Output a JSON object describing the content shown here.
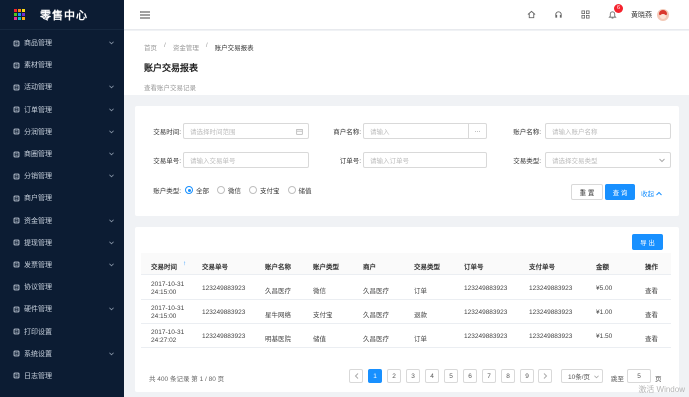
{
  "app": {
    "title": "零售中心"
  },
  "colors": {
    "sidebar_bg": "#0c1c33",
    "primary": "#1890ff",
    "badge": "#f5222d",
    "logo_tiles": [
      "#f5222d",
      "#fa8c16",
      "#fadb14",
      "#52c41a",
      "#1890ff",
      "#722ed1",
      "#eb2f96",
      "#13c2c2",
      "#faad14"
    ]
  },
  "sidebar": {
    "items": [
      {
        "label": "商品管理",
        "icon": "tag-icon",
        "chev": true
      },
      {
        "label": "素材管理",
        "icon": "file-icon",
        "chev": false
      },
      {
        "label": "活动管理",
        "icon": "calendar-icon",
        "chev": true
      },
      {
        "label": "订单管理",
        "icon": "order-icon",
        "chev": true
      },
      {
        "label": "分润管理",
        "icon": "share-icon",
        "chev": true
      },
      {
        "label": "商圈管理",
        "icon": "grid-icon",
        "chev": true
      },
      {
        "label": "分销管理",
        "icon": "distribution-icon",
        "chev": true
      },
      {
        "label": "商户管理",
        "icon": "store-icon",
        "chev": false
      },
      {
        "label": "资金管理",
        "icon": "wallet-icon",
        "chev": true
      },
      {
        "label": "提现管理",
        "icon": "withdraw-icon",
        "chev": true
      },
      {
        "label": "发票管理",
        "icon": "invoice-icon",
        "chev": true
      },
      {
        "label": "协议管理",
        "icon": "contract-icon",
        "chev": false
      },
      {
        "label": "硬件管理",
        "icon": "hardware-icon",
        "chev": true
      },
      {
        "label": "打印设置",
        "icon": "print-icon",
        "chev": false
      },
      {
        "label": "系统设置",
        "icon": "settings-icon",
        "chev": true
      },
      {
        "label": "日志管理",
        "icon": "log-icon",
        "chev": false
      }
    ]
  },
  "header": {
    "notification_count": "6",
    "username": "黄晓燕"
  },
  "breadcrumb": [
    "首页",
    "资金管理",
    "账户交易报表"
  ],
  "page": {
    "title": "账户交易报表",
    "description": "查看账户交易记录"
  },
  "filters": {
    "trade_time": {
      "label": "交易时间:",
      "placeholder": "请选择时间范围"
    },
    "merchant_name": {
      "label": "商户名称:",
      "placeholder": "请输入"
    },
    "account_name": {
      "label": "账户名称:",
      "placeholder": "请输入账户名称"
    },
    "trade_no": {
      "label": "交易单号:",
      "placeholder": "请输入交易单号"
    },
    "order_no": {
      "label": "订单号:",
      "placeholder": "请输入订单号"
    },
    "trade_type": {
      "label": "交易类型:",
      "placeholder": "请选择交易类型"
    },
    "account_type": {
      "label": "账户类型:",
      "options": [
        "全部",
        "微信",
        "支付宝",
        "储值"
      ],
      "selected": "全部"
    },
    "reset_label": "重 置",
    "search_label": "查 询",
    "collapse_label": "收起"
  },
  "table": {
    "export_label": "导 出",
    "columns": [
      "交易时间",
      "交易单号",
      "账户名称",
      "账户类型",
      "商户",
      "交易类型",
      "订单号",
      "支付单号",
      "金额",
      "操作"
    ],
    "rows": [
      {
        "time_date": "2017-10-31",
        "time_clock": "24:15:00",
        "trade_no": "123249883923",
        "account": "久昌医疗",
        "account_type": "微信",
        "merchant": "久昌医疗",
        "trade_type": "订单",
        "order_no": "123249883923",
        "pay_no": "123249883923",
        "amount": "¥5.00",
        "action": "查看"
      },
      {
        "time_date": "2017-10-31",
        "time_clock": "24:15:00",
        "trade_no": "123249883923",
        "account": "星牛网络",
        "account_type": "支付宝",
        "merchant": "久昌医疗",
        "trade_type": "退款",
        "order_no": "123249883923",
        "pay_no": "123249883923",
        "amount": "¥1.00",
        "action": "查看"
      },
      {
        "time_date": "2017-10-31",
        "time_clock": "24:27:02",
        "trade_no": "123249883923",
        "account": "明基医院",
        "account_type": "储值",
        "merchant": "久昌医疗",
        "trade_type": "订单",
        "order_no": "123249883923",
        "pay_no": "123249883923",
        "amount": "¥1.50",
        "action": "查看"
      }
    ]
  },
  "pagination": {
    "summary": "共 400 条记录 第 1 / 80 页",
    "pages": [
      "1",
      "2",
      "3",
      "4",
      "5",
      "6",
      "7",
      "8",
      "9"
    ],
    "current": "1",
    "page_size": "10条/页",
    "jump_label": "跳至",
    "jump_value": "5",
    "page_unit": "页"
  },
  "watermark": "激活 Window"
}
